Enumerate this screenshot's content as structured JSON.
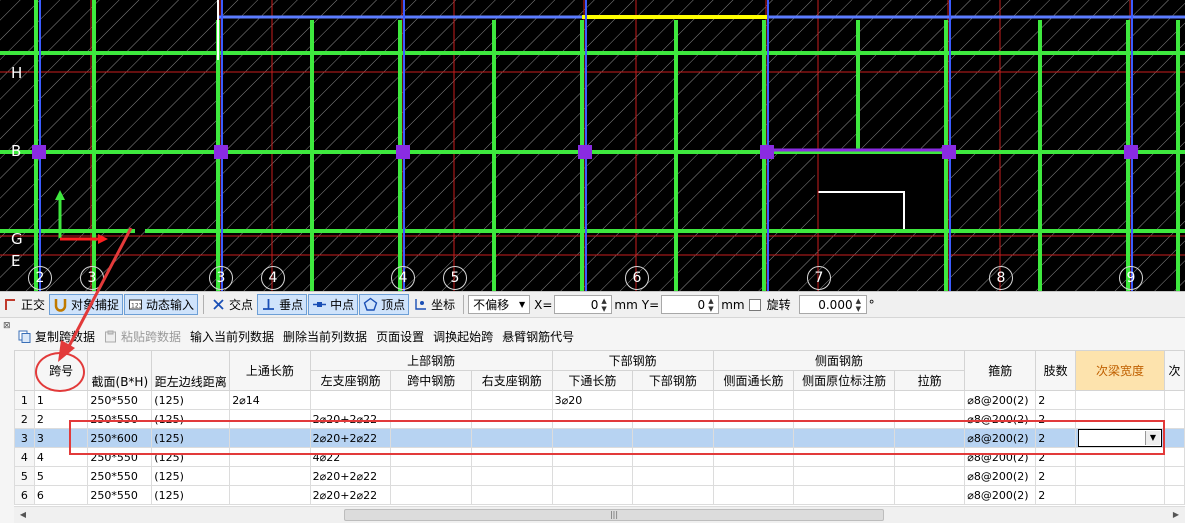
{
  "cad": {
    "axis_letters": [
      "H",
      "B",
      "G",
      "E"
    ],
    "axis_numbers": [
      "2",
      "3",
      "3",
      "4",
      "4",
      "5",
      "6",
      "7",
      "8",
      "9"
    ]
  },
  "snapbar": {
    "ortho": "正交",
    "object_snap": "对象捕捉",
    "dynamic_input": "动态输入",
    "intersection": "交点",
    "perpendicular": "垂点",
    "midpoint": "中点",
    "vertex": "顶点",
    "coordinate": "坐标",
    "offset_select": "不偏移",
    "x_label": "X=",
    "x_value": "0",
    "x_unit": "mm",
    "y_label": "Y=",
    "y_value": "0",
    "y_unit": "mm",
    "rotate": "旋转",
    "rotate_value": "0.000",
    "degree": "°"
  },
  "grid_toolbar": {
    "copy_span": "复制跨数据",
    "paste_span": "粘贴跨数据",
    "input_column": "输入当前列数据",
    "delete_column": "删除当前列数据",
    "page_setup": "页面设置",
    "change_start_span": "调换起始跨",
    "cantilever_code": "悬臂钢筋代号"
  },
  "table": {
    "group_headers": {
      "top_rebar": "上部钢筋",
      "bottom_rebar": "下部钢筋",
      "side_rebar": "侧面钢筋"
    },
    "headers": {
      "span_no": "跨号",
      "section": "截面(B*H)",
      "edge_distance": "距左边线距离",
      "top_through": "上通长筋",
      "left_support": "左支座钢筋",
      "mid_span": "跨中钢筋",
      "right_support": "右支座钢筋",
      "bottom_through": "下通长筋",
      "bottom_rebar": "下部钢筋",
      "side_through": "侧面通长筋",
      "side_in_situ": "侧面原位标注筋",
      "tie": "拉筋",
      "stirrup": "箍筋",
      "legs": "肢数",
      "secondary_width": "次梁宽度",
      "secondary_more": "次"
    },
    "rows": [
      {
        "num": "1",
        "span": "1",
        "section": "250*550",
        "dist": "(125)",
        "top": "2⌀14",
        "left": "",
        "mid": "",
        "right": "",
        "btm": "3⌀20",
        "btm2": "",
        "side": "",
        "side2": "",
        "tie": "",
        "stirrup": "⌀8@200(2)",
        "legs": "2"
      },
      {
        "num": "2",
        "span": "2",
        "section": "250*550",
        "dist": "(125)",
        "top": "",
        "left": "2⌀20+2⌀22",
        "mid": "",
        "right": "",
        "btm": "",
        "btm2": "",
        "side": "",
        "side2": "",
        "tie": "",
        "stirrup": "⌀8@200(2)",
        "legs": "2"
      },
      {
        "num": "3",
        "span": "3",
        "section": "250*600",
        "dist": "(125)",
        "top": "",
        "left": "2⌀20+2⌀22",
        "mid": "",
        "right": "",
        "btm": "",
        "btm2": "",
        "side": "",
        "side2": "",
        "tie": "",
        "stirrup": "⌀8@200(2)",
        "legs": "2"
      },
      {
        "num": "4",
        "span": "4",
        "section": "250*550",
        "dist": "(125)",
        "top": "",
        "left": "4⌀22",
        "mid": "",
        "right": "",
        "btm": "",
        "btm2": "",
        "side": "",
        "side2": "",
        "tie": "",
        "stirrup": "⌀8@200(2)",
        "legs": "2"
      },
      {
        "num": "5",
        "span": "5",
        "section": "250*550",
        "dist": "(125)",
        "top": "",
        "left": "2⌀20+2⌀22",
        "mid": "",
        "right": "",
        "btm": "",
        "btm2": "",
        "side": "",
        "side2": "",
        "tie": "",
        "stirrup": "⌀8@200(2)",
        "legs": "2"
      },
      {
        "num": "6",
        "span": "6",
        "section": "250*550",
        "dist": "(125)",
        "top": "",
        "left": "2⌀20+2⌀22",
        "mid": "",
        "right": "",
        "btm": "",
        "btm2": "",
        "side": "",
        "side2": "",
        "tie": "",
        "stirrup": "⌀8@200(2)",
        "legs": "2"
      }
    ]
  },
  "colors": {
    "beam_green": "#3ee83e",
    "axis_red": "#c81e1e",
    "column_purple": "#8a2be2",
    "selected_row": "#b7d3f2",
    "annotation_red": "#e23a3a"
  }
}
